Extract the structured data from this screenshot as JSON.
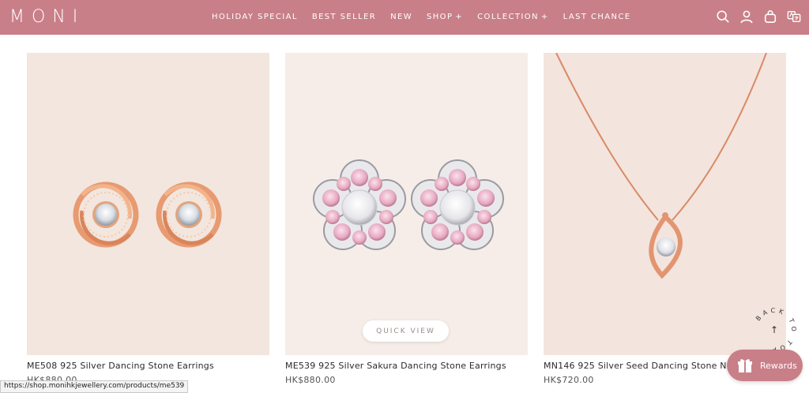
{
  "header": {
    "logo": "MONI",
    "nav": [
      {
        "label": "HOLIDAY SPECIAL",
        "has_plus": false
      },
      {
        "label": "BEST SELLER",
        "has_plus": false
      },
      {
        "label": "NEW",
        "has_plus": false
      },
      {
        "label": "SHOP",
        "has_plus": true
      },
      {
        "label": "COLLECTION",
        "has_plus": true
      },
      {
        "label": "LAST CHANCE",
        "has_plus": false
      }
    ],
    "plus_symbol": "+",
    "icons": [
      "search-icon",
      "account-icon",
      "cart-icon",
      "translate-icon"
    ],
    "color": "#c97f88"
  },
  "products": [
    {
      "title": "ME508 925 Silver Dancing Stone Earrings",
      "price": "HK$880.00"
    },
    {
      "title": "ME539 925 Silver Sakura Dancing Stone Earrings",
      "price": "HK$880.00"
    },
    {
      "title": "MN146 925 Silver Seed Dancing Stone Neckla",
      "price": "HK$720.00"
    }
  ],
  "quick_view": "QUICK VIEW",
  "status_url": "https://shop.monihkjewellery.com/products/me539",
  "back_to_top": {
    "text": "BACK TO TOP",
    "arrow": "↑"
  },
  "rewards": {
    "label": "Rewards",
    "icon": "gift-icon"
  }
}
